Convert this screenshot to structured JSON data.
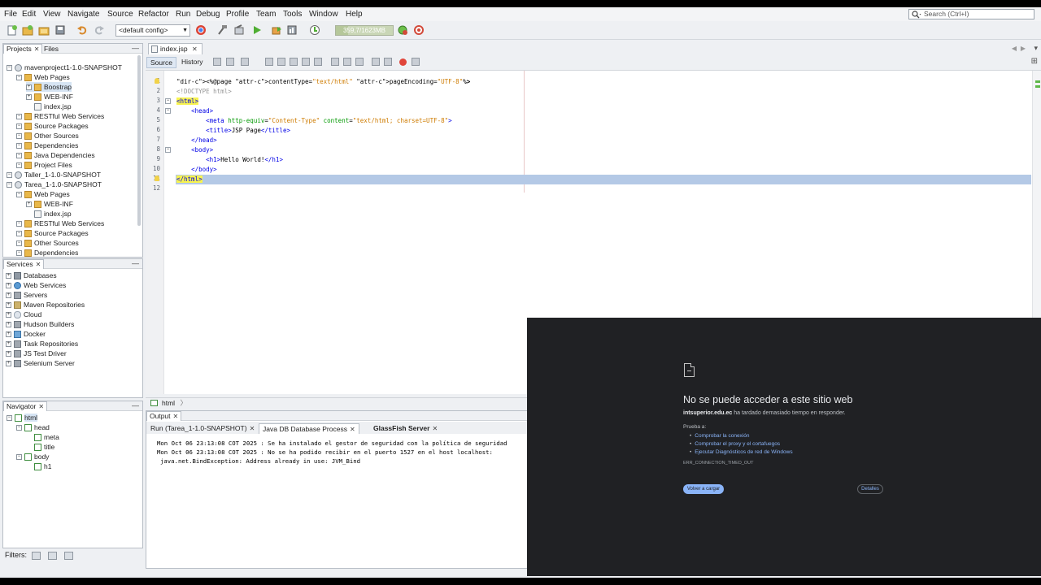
{
  "menubar": {
    "items": [
      "File",
      "Edit",
      "View",
      "Navigate",
      "Source",
      "Refactor",
      "Run",
      "Debug",
      "Profile",
      "Team",
      "Tools",
      "Window",
      "Help"
    ],
    "search_placeholder": "Search (Ctrl+I)"
  },
  "toolbar": {
    "config": "<default config>",
    "memory": "359,7/1623MB",
    "memory_fraction": 0.22
  },
  "projects_panel": {
    "tabs": [
      "Projects",
      "Files"
    ],
    "tree": [
      {
        "label": "mavenproject1-1.0-SNAPSHOT",
        "level": 0,
        "icon": "project-icon"
      },
      {
        "label": "Web Pages",
        "level": 1,
        "icon": "folder-icon"
      },
      {
        "label": "Boostrap",
        "level": 2,
        "icon": "folder-icon"
      },
      {
        "label": "WEB-INF",
        "level": 2,
        "icon": "folder-icon"
      },
      {
        "label": "index.jsp",
        "level": 2,
        "icon": "file-icon"
      },
      {
        "label": "RESTful Web Services",
        "level": 1,
        "icon": "folder-icon"
      },
      {
        "label": "Source Packages",
        "level": 1,
        "icon": "folder-icon"
      },
      {
        "label": "Other Sources",
        "level": 1,
        "icon": "folder-icon"
      },
      {
        "label": "Dependencies",
        "level": 1,
        "icon": "folder-icon"
      },
      {
        "label": "Java Dependencies",
        "level": 1,
        "icon": "folder-icon"
      },
      {
        "label": "Project Files",
        "level": 1,
        "icon": "folder-icon"
      },
      {
        "label": "Taller_1-1.0-SNAPSHOT",
        "level": 0,
        "icon": "project-icon"
      },
      {
        "label": "Tarea_1-1.0-SNAPSHOT",
        "level": 0,
        "icon": "project-icon"
      },
      {
        "label": "Web Pages",
        "level": 1,
        "icon": "folder-icon"
      },
      {
        "label": "WEB-INF",
        "level": 2,
        "icon": "folder-icon"
      },
      {
        "label": "index.jsp",
        "level": 2,
        "icon": "file-icon"
      },
      {
        "label": "RESTful Web Services",
        "level": 1,
        "icon": "folder-icon"
      },
      {
        "label": "Source Packages",
        "level": 1,
        "icon": "folder-icon"
      },
      {
        "label": "Other Sources",
        "level": 1,
        "icon": "folder-icon"
      },
      {
        "label": "Dependencies",
        "level": 1,
        "icon": "folder-icon"
      }
    ]
  },
  "services_panel": {
    "title": "Services",
    "items": [
      "Databases",
      "Web Services",
      "Servers",
      "Maven Repositories",
      "Cloud",
      "Hudson Builders",
      "Docker",
      "Task Repositories",
      "JS Test Driver",
      "Selenium Server"
    ]
  },
  "navigator_panel": {
    "title": "Navigator",
    "tree": [
      {
        "label": "html",
        "level": 0
      },
      {
        "label": "head",
        "level": 1
      },
      {
        "label": "meta",
        "level": 2
      },
      {
        "label": "title",
        "level": 2
      },
      {
        "label": "body",
        "level": 1
      },
      {
        "label": "h1",
        "level": 2
      }
    ],
    "filters_label": "Filters:"
  },
  "editor": {
    "tab": "index.jsp",
    "source_tab": "Source",
    "history_tab": "History",
    "line_numbers": [
      "1",
      "2",
      "3",
      "4",
      "5",
      "6",
      "7",
      "8",
      "9",
      "10",
      "11",
      "12"
    ],
    "lines": [
      "<%@page contentType=\"text/html\" pageEncoding=\"UTF-8\"%>",
      "<!DOCTYPE html>",
      "<html>",
      "    <head>",
      "        <meta http-equiv=\"Content-Type\" content=\"text/html; charset=UTF-8\">",
      "        <title>JSP Page</title>",
      "    </head>",
      "    <body>",
      "        <h1>Hello World!</h1>",
      "    </body>",
      "</html>",
      ""
    ],
    "breadcrumb": "html"
  },
  "output": {
    "title": "Output",
    "tabs": [
      "Run (Tarea_1-1.0-SNAPSHOT)",
      "Java DB Database Process",
      "GlassFish Server"
    ],
    "lines": [
      "Mon Oct 06 23:13:08 COT 2025 : Se ha instalado el gestor de seguridad con la política de seguridad",
      "Mon Oct 06 23:13:08 COT 2025 : No se ha podido recibir en el puerto 1527 en el host localhost:",
      "java.net.BindException: Address already in use: JVM_Bind"
    ]
  },
  "browser_error": {
    "title": "No se puede acceder a este sitio web",
    "host": "intsuperior.edu.ec",
    "host_suffix": " ha tardado demasiado tiempo en responder.",
    "try_label": "Prueba a:",
    "suggestions": [
      "Comprobar la conexión",
      "Comprobar el proxy y el cortafuegos",
      "Ejecutar Diagnósticos de red de Windows"
    ],
    "error_code": "ERR_CONNECTION_TIMED_OUT",
    "reload_button": "Volver a cargar",
    "details_button": "Detalles"
  }
}
